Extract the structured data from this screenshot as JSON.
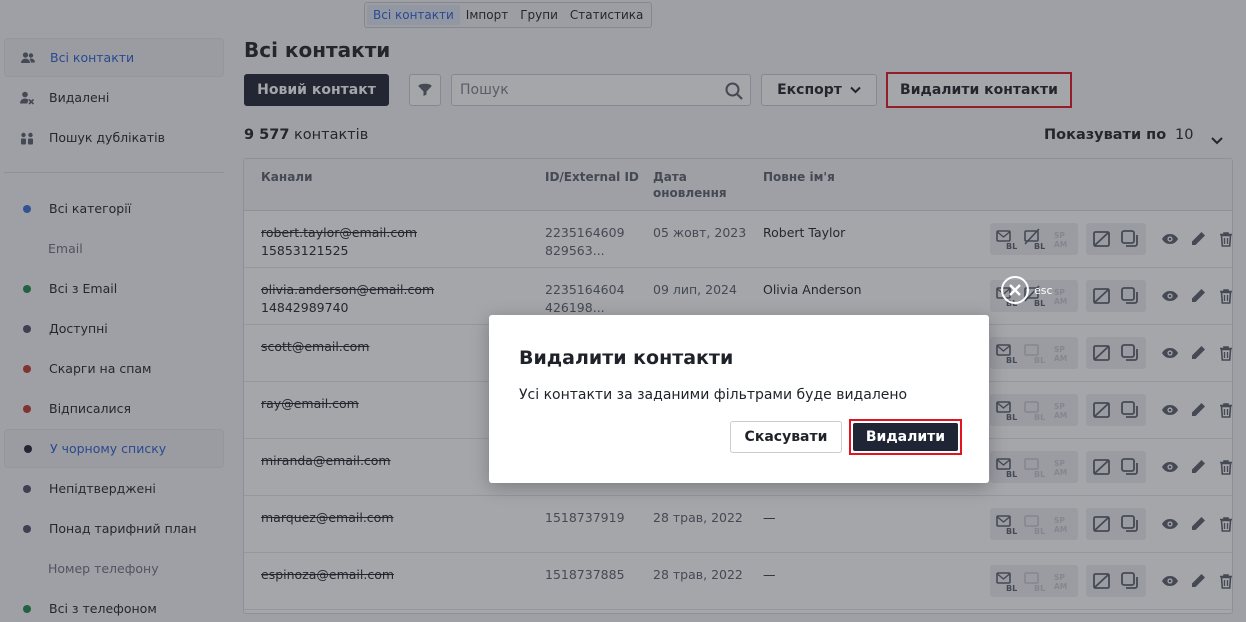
{
  "top_tabs": [
    {
      "label": "Всі контакти",
      "active": true
    },
    {
      "label": "Імпорт"
    },
    {
      "label": "Групи"
    },
    {
      "label": "Статистика"
    }
  ],
  "sidebar": {
    "items": [
      {
        "label": "Всі контакти",
        "icon": "users-icon",
        "active": true
      },
      {
        "label": "Видалені",
        "icon": "user-deleted-icon"
      },
      {
        "label": "Пошук дублікатів",
        "icon": "duplicates-icon"
      }
    ],
    "categories": [
      {
        "label": "Всі категорії",
        "color": "#3b6fd8"
      },
      {
        "label": "Email",
        "sub": true
      },
      {
        "label": "Всі з Email",
        "color": "#1e8a4e"
      },
      {
        "label": "Доступні",
        "color": "#4a5068"
      },
      {
        "label": "Скарги на спам",
        "color": "#c0392b"
      },
      {
        "label": "Відписалися",
        "color": "#c0392b"
      },
      {
        "label": "У чорному списку",
        "color": "#1f2535",
        "active": true
      },
      {
        "label": "Непідтверджені",
        "color": "#4a5068"
      },
      {
        "label": "Понад тарифний план",
        "color": "#4a5068"
      },
      {
        "label": "Номер телефону",
        "sub": true
      },
      {
        "label": "Всі з телефоном",
        "color": "#1e8a4e"
      }
    ]
  },
  "main": {
    "title": "Всі контакти",
    "new_contact": "Новий контакт",
    "search_placeholder": "Пошук",
    "export_label": "Експорт",
    "delete_contacts": "Видалити контакти",
    "count_number": "9 577",
    "count_suffix": "контактів",
    "per_page_label": "Показувати по",
    "per_page_value": "10"
  },
  "table": {
    "headers": {
      "channels": "Канали",
      "id": "ID/External ID",
      "date_line1": "Дата",
      "date_line2": "оновлення",
      "name": "Повне ім'я"
    },
    "rows": [
      {
        "email": "robert.taylor@email.com",
        "phone": "15853121525",
        "id1": "2235164609",
        "id2": "829563...",
        "date": "05 жовт, 2023",
        "name": "Robert Taylor"
      },
      {
        "email": "olivia.anderson@email.com",
        "phone": "14842989740",
        "id1": "2235164604",
        "id2": "426198...",
        "date": "09 лип, 2024",
        "name": "Olivia Anderson"
      },
      {
        "email": "scott@email.com",
        "phone": "",
        "id1": "",
        "id2": "",
        "date": "",
        "name": ""
      },
      {
        "email": "ray@email.com",
        "phone": "",
        "id1": "",
        "id2": "",
        "date": "",
        "name": ""
      },
      {
        "email": "miranda@email.com",
        "phone": "",
        "id1": "",
        "id2": "",
        "date": "",
        "name": ""
      },
      {
        "email": "marquez@email.com",
        "phone": "",
        "id1": "1518737919",
        "id2": "",
        "date": "28 трав, 2022",
        "name": "—"
      },
      {
        "email": "espinoza@email.com",
        "phone": "",
        "id1": "1518737885",
        "id2": "",
        "date": "28 трав, 2022",
        "name": "—"
      }
    ],
    "chip_labels": {
      "bl": "BL",
      "sp": "SP",
      "am": "AM"
    }
  },
  "overlay": {
    "esc_label": "esc"
  },
  "modal": {
    "title": "Видалити контакти",
    "text": "Усі контакти за заданими фільтрами буде видалено",
    "cancel": "Скасувати",
    "confirm": "Видалити"
  },
  "colors": {
    "primary": "#1f2535",
    "accent": "#2c5fd1",
    "highlight": "#e1141f"
  }
}
